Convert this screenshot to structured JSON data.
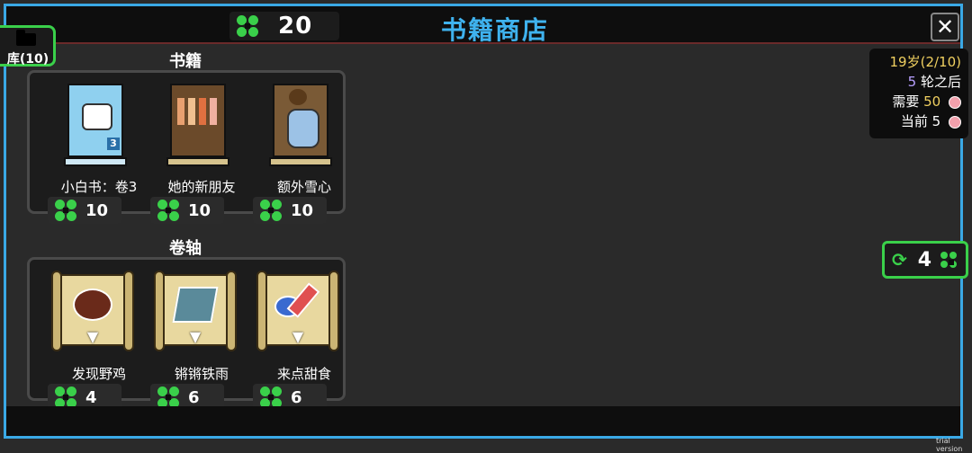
{
  "header": {
    "title": "书籍商店",
    "currency_value": "20"
  },
  "library_button": {
    "label": "库(10)"
  },
  "sections": [
    {
      "title": "书籍",
      "items": [
        {
          "name": "小白书：卷3",
          "price": "10"
        },
        {
          "name": "她的新朋友",
          "price": "10"
        },
        {
          "name": "额外雪心",
          "price": "10"
        }
      ]
    },
    {
      "title": "卷轴",
      "items": [
        {
          "name": "发现野鸡",
          "price": "4"
        },
        {
          "name": "锵锵铁雨",
          "price": "6"
        },
        {
          "name": "来点甜食",
          "price": "6"
        }
      ]
    }
  ],
  "info": {
    "age": "19岁(2/10)",
    "rounds_num": "5",
    "rounds_text": "轮之后",
    "need_label": "需要",
    "need_value": "50",
    "current_label": "当前",
    "current_value": "5"
  },
  "reroll": {
    "cost": "4"
  },
  "watermark": "trial version",
  "colors": {
    "accent_green": "#3ad04a",
    "title_blue": "#3fb2ee",
    "gem_pink": "#f2a0ac",
    "gold": "#f0d060",
    "purple": "#b8a0ff"
  }
}
